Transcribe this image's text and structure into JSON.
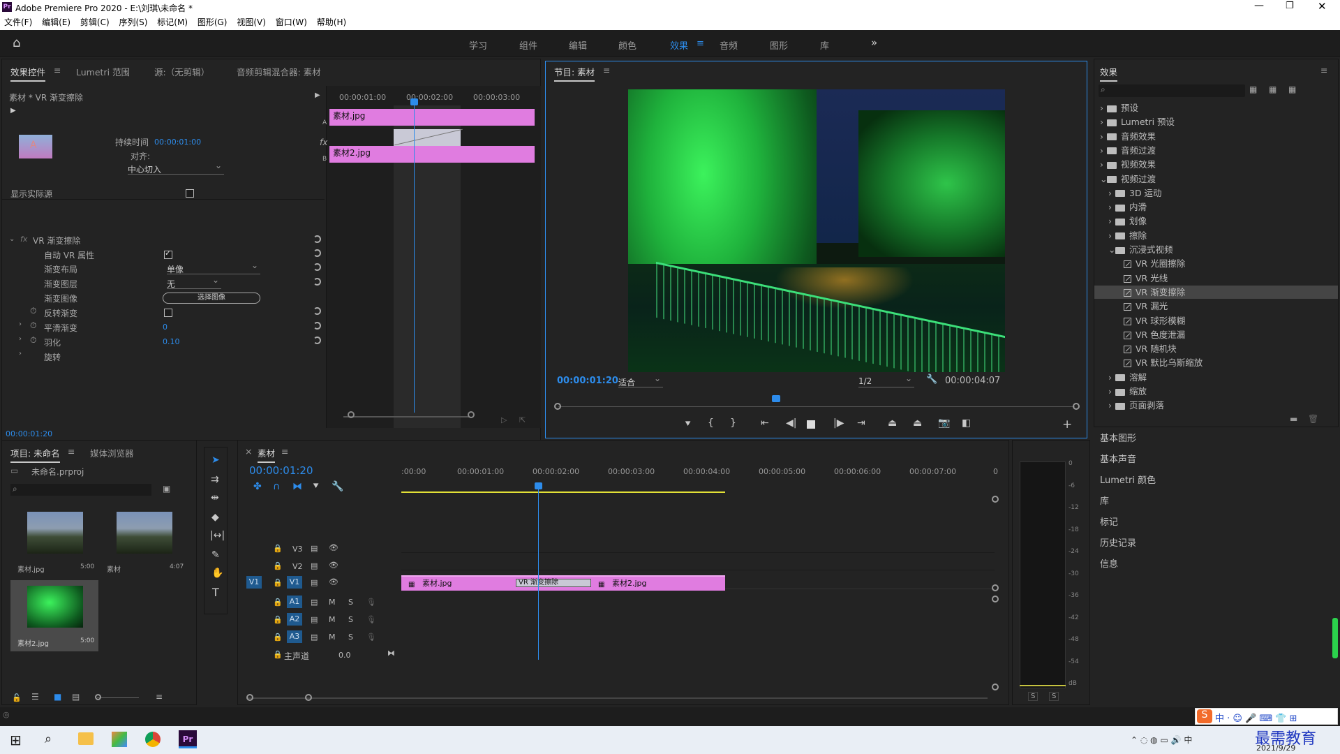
{
  "app": {
    "title": "Adobe Premiere Pro 2020 - E:\\刘琪\\未命名 *",
    "logo": "Pr"
  },
  "menu": [
    "文件(F)",
    "编辑(E)",
    "剪辑(C)",
    "序列(S)",
    "标记(M)",
    "图形(G)",
    "视图(V)",
    "窗口(W)",
    "帮助(H)"
  ],
  "workspaces": [
    "学习",
    "组件",
    "编辑",
    "颜色",
    "效果",
    "音频",
    "图形",
    "库"
  ],
  "workspace_active": "效果",
  "effect_controls": {
    "tabs": [
      "效果控件",
      "Lumetri 范围",
      "源:（无剪辑）",
      "音频剪辑混合器: 素材"
    ],
    "clip_label": "素材 * VR 渐变擦除",
    "ruler": [
      "00:00:01:00",
      "00:00:02:00",
      "00:00:03:00"
    ],
    "clip_a": "素材.jpg",
    "clip_b": "素材2.jpg",
    "track_a": "A",
    "track_b": "B",
    "duration_label": "持续时间",
    "duration_value": "00:00:01:00",
    "align_label": "对齐:",
    "align_value": "中心切入",
    "show_source_label": "显示实际源",
    "effect_name": "VR 渐变擦除",
    "params": {
      "auto_vr": "自动 VR 属性",
      "layout_label": "渐变布局",
      "layout_value": "单像",
      "layer_label": "渐变图层",
      "layer_value": "无",
      "image_label": "渐变图像",
      "image_button": "选择图像",
      "invert_label": "反转渐变",
      "smooth_label": "平滑渐变",
      "smooth_value": "0",
      "feather_label": "羽化",
      "feather_value": "0.10",
      "rotate_label": "旋转"
    },
    "timecode": "00:00:01:20"
  },
  "program": {
    "tab": "节目: 素材",
    "timecode": "00:00:01:20",
    "fit": "适合",
    "resolution": "1/2",
    "duration": "00:00:04:07"
  },
  "effects": {
    "title": "效果",
    "tree": [
      {
        "label": "预设",
        "type": "folder",
        "level": 0,
        "open": false
      },
      {
        "label": "Lumetri 预设",
        "type": "folder",
        "level": 0,
        "open": false
      },
      {
        "label": "音频效果",
        "type": "folder",
        "level": 0,
        "open": false
      },
      {
        "label": "音频过渡",
        "type": "folder",
        "level": 0,
        "open": false
      },
      {
        "label": "视频效果",
        "type": "folder",
        "level": 0,
        "open": false
      },
      {
        "label": "视频过渡",
        "type": "folder",
        "level": 0,
        "open": true
      },
      {
        "label": "3D 运动",
        "type": "folder",
        "level": 1,
        "open": false
      },
      {
        "label": "内滑",
        "type": "folder",
        "level": 1,
        "open": false
      },
      {
        "label": "划像",
        "type": "folder",
        "level": 1,
        "open": false
      },
      {
        "label": "擦除",
        "type": "folder",
        "level": 1,
        "open": false
      },
      {
        "label": "沉浸式视频",
        "type": "folder",
        "level": 1,
        "open": true
      },
      {
        "label": "VR 光圈擦除",
        "type": "fx",
        "level": 2
      },
      {
        "label": "VR 光线",
        "type": "fx",
        "level": 2
      },
      {
        "label": "VR 渐变擦除",
        "type": "fx",
        "level": 2,
        "selected": true
      },
      {
        "label": "VR 漏光",
        "type": "fx",
        "level": 2
      },
      {
        "label": "VR 球形模糊",
        "type": "fx",
        "level": 2
      },
      {
        "label": "VR 色度泄漏",
        "type": "fx",
        "level": 2
      },
      {
        "label": "VR 随机块",
        "type": "fx",
        "level": 2
      },
      {
        "label": "VR 默比乌斯缩放",
        "type": "fx",
        "level": 2
      },
      {
        "label": "溶解",
        "type": "folder",
        "level": 1,
        "open": false
      },
      {
        "label": "缩放",
        "type": "folder",
        "level": 1,
        "open": false
      },
      {
        "label": "页面剥落",
        "type": "folder",
        "level": 1,
        "open": false
      }
    ],
    "side_panels": [
      "基本图形",
      "基本声音",
      "Lumetri 颜色",
      "库",
      "标记",
      "历史记录",
      "信息"
    ]
  },
  "project": {
    "tabs": [
      "项目: 未命名",
      "媒体浏览器"
    ],
    "file": "未命名.prproj",
    "items": [
      {
        "name": "素材.jpg",
        "dur": "5:00"
      },
      {
        "name": "素材",
        "dur": "4:07"
      },
      {
        "name": "素材2.jpg",
        "dur": "5:00"
      }
    ]
  },
  "timeline": {
    "tab": "素材",
    "timecode": "00:00:01:20",
    "ruler": [
      ":00:00",
      "00:00:01:00",
      "00:00:02:00",
      "00:00:03:00",
      "00:00:04:00",
      "00:00:05:00",
      "00:00:06:00",
      "00:00:07:00",
      "0"
    ],
    "tracks_video": [
      "V3",
      "V2",
      "V1"
    ],
    "tracks_audio": [
      "A1",
      "A2",
      "A3"
    ],
    "src_v1": "V1",
    "master_label": "主声道",
    "master_value": "0.0",
    "clip1": "素材.jpg",
    "transition": "VR 渐变擦除",
    "clip2": "素材2.jpg",
    "m": "M",
    "s": "S"
  },
  "meter": {
    "scale": [
      "0",
      "-6",
      "-12",
      "-18",
      "-24",
      "-30",
      "-36",
      "-42",
      "-48",
      "-54",
      "dB"
    ],
    "solo": [
      "S",
      "S"
    ]
  },
  "watermark": {
    "brand": "最需教育",
    "date": "2021/9/29"
  },
  "colors": {
    "accent": "#2d8ceb",
    "clip": "#e07ce0",
    "panel": "#232323"
  }
}
